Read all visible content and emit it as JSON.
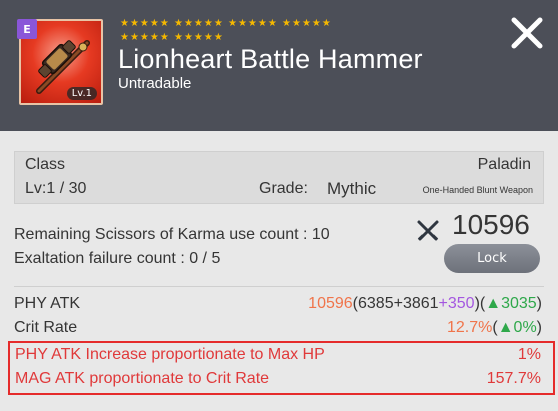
{
  "item": {
    "grade_letter": "E",
    "level_badge": "Lv.1",
    "star_rows": [
      "★★★★★ ★★★★★ ★★★★★ ★★★★★",
      "★★★★★ ★★★★★"
    ],
    "name": "Lionheart Battle Hammer",
    "tradability": "Untradable"
  },
  "info": {
    "class_label": "Class",
    "class_value": "Paladin",
    "level": "Lv:1 / 30",
    "grade_label": "Grade:",
    "grade_value": "Mythic",
    "weapon_type": "One-Handed Blunt Weapon"
  },
  "counts": {
    "scissors": "Remaining Scissors of Karma use count :  10",
    "exaltation": "Exaltation failure count : 0 / 5",
    "power_score": "10596",
    "lock_label": "Lock"
  },
  "stats": {
    "phy_atk_label": "PHY ATK",
    "phy_atk_total": "10596",
    "phy_atk_breakdown_open": "(6385+3861",
    "phy_atk_bonus": "+350",
    "phy_atk_mid": ")(",
    "phy_atk_delta": "▲3035",
    "phy_atk_close": ")",
    "crit_label": "Crit Rate",
    "crit_value": "12.7%",
    "crit_open": "(",
    "crit_delta": "▲0%",
    "crit_close": ")"
  },
  "special_stats": [
    {
      "label": "PHY ATK Increase proportionate to Max HP",
      "value": "1%"
    },
    {
      "label": "MAG ATK proportionate to Crit Rate",
      "value": "157.7%"
    }
  ],
  "colors": {
    "header_bg": "#4c4f58",
    "star": "#f4b800",
    "grade_badge": "#8a56d8",
    "orange": "#f0744a",
    "purple": "#a457e0",
    "green": "#2ea84a",
    "special_red": "#e0393a"
  },
  "icons": {
    "close": "close-icon",
    "power_score": "crossed-swords-icon",
    "item": "battle-hammer-icon"
  }
}
